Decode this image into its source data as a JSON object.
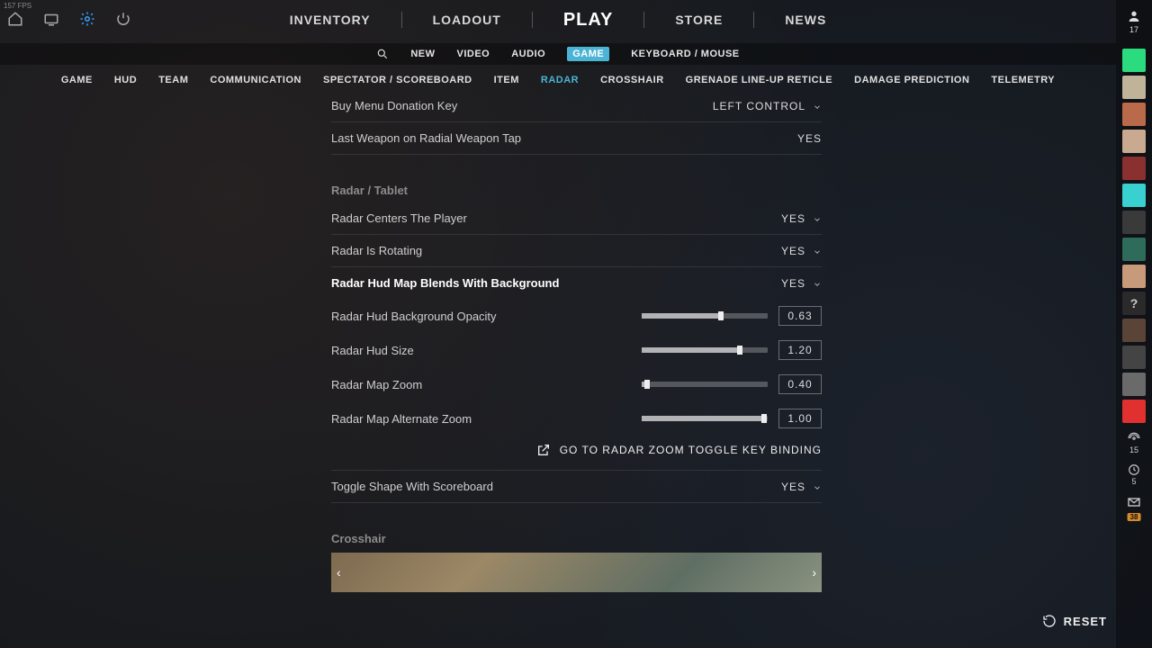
{
  "fps": "157 FPS",
  "topnav": {
    "inventory": "INVENTORY",
    "loadout": "LOADOUT",
    "play": "PLAY",
    "store": "STORE",
    "news": "NEWS"
  },
  "tabs1": {
    "new": "NEW",
    "video": "VIDEO",
    "audio": "AUDIO",
    "game": "GAME",
    "keyboard": "KEYBOARD / MOUSE"
  },
  "tabs2": {
    "game": "GAME",
    "hud": "HUD",
    "team": "TEAM",
    "communication": "COMMUNICATION",
    "spectator": "SPECTATOR / SCOREBOARD",
    "item": "ITEM",
    "radar": "RADAR",
    "crosshair": "CROSSHAIR",
    "grenade": "GRENADE LINE-UP RETICLE",
    "damage": "DAMAGE PREDICTION",
    "telemetry": "TELEMETRY"
  },
  "rows": {
    "buyMenuDonation": {
      "label": "Buy Menu Donation Key",
      "value": "LEFT CONTROL"
    },
    "lastWeaponTap": {
      "label": "Last Weapon on Radial Weapon Tap",
      "value": "YES"
    }
  },
  "sections": {
    "radar": "Radar / Tablet",
    "crosshair": "Crosshair"
  },
  "radar": {
    "centers": {
      "label": "Radar Centers The Player",
      "value": "YES"
    },
    "rotating": {
      "label": "Radar Is Rotating",
      "value": "YES"
    },
    "blends": {
      "label": "Radar Hud Map Blends With Background",
      "value": "YES"
    },
    "bgOpacity": {
      "label": "Radar Hud Background Opacity",
      "value": "0.63",
      "pct": 63
    },
    "hudSize": {
      "label": "Radar Hud Size",
      "value": "1.20",
      "pct": 78
    },
    "mapZoom": {
      "label": "Radar Map Zoom",
      "value": "0.40",
      "pct": 4
    },
    "altZoom": {
      "label": "Radar Map Alternate Zoom",
      "value": "1.00",
      "pct": 97
    },
    "link": "GO TO RADAR ZOOM TOGGLE KEY BINDING",
    "toggleShape": {
      "label": "Toggle Shape With Scoreboard",
      "value": "YES"
    }
  },
  "sidebar": {
    "meCount": "17",
    "broadcast": "15",
    "history": "5",
    "mail": "38"
  },
  "reset": "RESET"
}
